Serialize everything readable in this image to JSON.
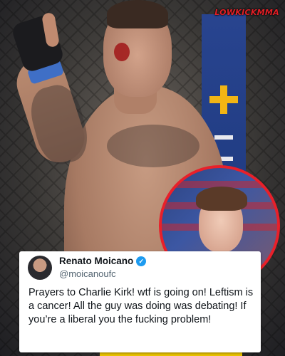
{
  "logo": {
    "text": "LOWKICKMMA"
  },
  "tweet": {
    "author_name": "Renato Moicano",
    "handle": "@moicanoufc",
    "verified": true,
    "text": "Prayers to Charlie Kirk! wtf is going on! Leftism is a cancer! All the guy was doing was debating! If you’re a liberal you the fucking problem!"
  },
  "colors": {
    "verified_badge": "#1d9bf0",
    "inset_border": "#e8202a",
    "logo": "#e21f26"
  },
  "icons": {
    "verified": "check-icon"
  }
}
